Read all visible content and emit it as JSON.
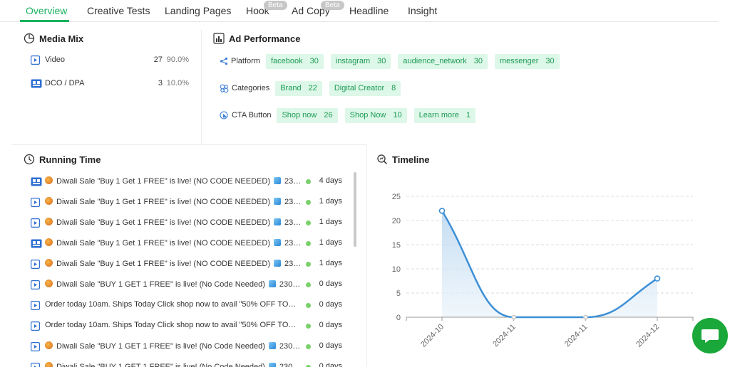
{
  "tabs": [
    {
      "label": "Overview",
      "active": true
    },
    {
      "label": "Creative Tests"
    },
    {
      "label": "Landing Pages"
    },
    {
      "label": "Hook",
      "badge": "Beta"
    },
    {
      "label": "Ad Copy",
      "badge": "Beta"
    },
    {
      "label": "Headline"
    },
    {
      "label": "Insight"
    }
  ],
  "media_mix": {
    "title": "Media Mix",
    "items": [
      {
        "label": "Video",
        "count": "27",
        "pct": "90.0%",
        "icon": "video-icon"
      },
      {
        "label": "DCO / DPA",
        "count": "3",
        "pct": "10.0%",
        "icon": "dco-icon"
      }
    ]
  },
  "ad_performance": {
    "title": "Ad Performance",
    "platform": {
      "label": "Platform",
      "chips": [
        {
          "name": "facebook",
          "n": "30"
        },
        {
          "name": "instagram",
          "n": "30"
        },
        {
          "name": "audience_network",
          "n": "30"
        },
        {
          "name": "messenger",
          "n": "30"
        }
      ]
    },
    "categories": {
      "label": "Categories",
      "chips": [
        {
          "name": "Brand",
          "n": "22"
        },
        {
          "name": "Digital Creator",
          "n": "8"
        }
      ]
    },
    "cta": {
      "label": "CTA Button",
      "chips": [
        {
          "name": "Shop now",
          "n": "26"
        },
        {
          "name": "Shop Now",
          "n": "10"
        },
        {
          "name": "Learn more",
          "n": "1"
        }
      ]
    }
  },
  "running_time": {
    "title": "Running Time",
    "rows": [
      {
        "icon": "dco",
        "flame": true,
        "cube": true,
        "pre": "Diwali Sale \"Buy 1 Get 1 FREE\" is live! (NO CODE NEEDED)",
        "post": "230 Wa...",
        "days": "4 days"
      },
      {
        "icon": "video",
        "flame": true,
        "cube": true,
        "pre": "Diwali Sale \"Buy 1 Get 1 FREE\" is live! (NO CODE NEEDED)",
        "post": "230 Wa...",
        "days": "1 days"
      },
      {
        "icon": "video",
        "flame": true,
        "cube": true,
        "pre": "Diwali Sale \"Buy 1 Get 1 FREE\" is live! (NO CODE NEEDED)",
        "post": "230 Wa...",
        "days": "1 days"
      },
      {
        "icon": "dco",
        "flame": true,
        "cube": true,
        "pre": "Diwali Sale \"Buy 1 Get 1 FREE\" is live! (NO CODE NEEDED)",
        "post": "230 Wa...",
        "days": "1 days"
      },
      {
        "icon": "video",
        "flame": true,
        "cube": true,
        "pre": "Diwali Sale \"Buy 1 Get 1 FREE\" is live! (NO CODE NEEDED)",
        "post": "230 Wa...",
        "days": "1 days"
      },
      {
        "icon": "video",
        "flame": true,
        "cube": true,
        "pre": "Diwali Sale \"BUY 1 GET 1 FREE\" is live! (No Code Needed)",
        "post": "230 Wat...",
        "days": "0 days"
      },
      {
        "icon": "video",
        "flame": false,
        "cube": false,
        "pre": "Order today 10am. Ships Today Click shop now to avail \"50% OFF TODAY\"!",
        "post": "",
        "days": "0 days"
      },
      {
        "icon": "video",
        "flame": false,
        "cube": false,
        "pre": "Order today 10am. Ships Today Click shop now to avail \"50% OFF TODAY\"!",
        "post": "",
        "days": "0 days"
      },
      {
        "icon": "video",
        "flame": true,
        "cube": true,
        "pre": "Diwali Sale \"BUY 1 GET 1 FREE\" is live! (No Code Needed)",
        "post": "230 Wat...",
        "days": "0 days"
      },
      {
        "icon": "video",
        "flame": true,
        "cube": true,
        "pre": "Diwali Sale \"BUY 1 GET 1 FREE\" is live! (No Code Needed)",
        "post": "230 Wat...",
        "days": "0 days"
      }
    ]
  },
  "timeline": {
    "title": "Timeline"
  },
  "chart_data": {
    "type": "area",
    "categories": [
      "2024-10",
      "2024-11",
      "2024-11",
      "2024-12"
    ],
    "values": [
      22,
      0,
      0,
      8
    ],
    "ylim": [
      0,
      25
    ],
    "yticks": [
      "0",
      "5",
      "10",
      "15",
      "20",
      "25"
    ],
    "grid": true,
    "line_color": "#3d8fd6"
  }
}
